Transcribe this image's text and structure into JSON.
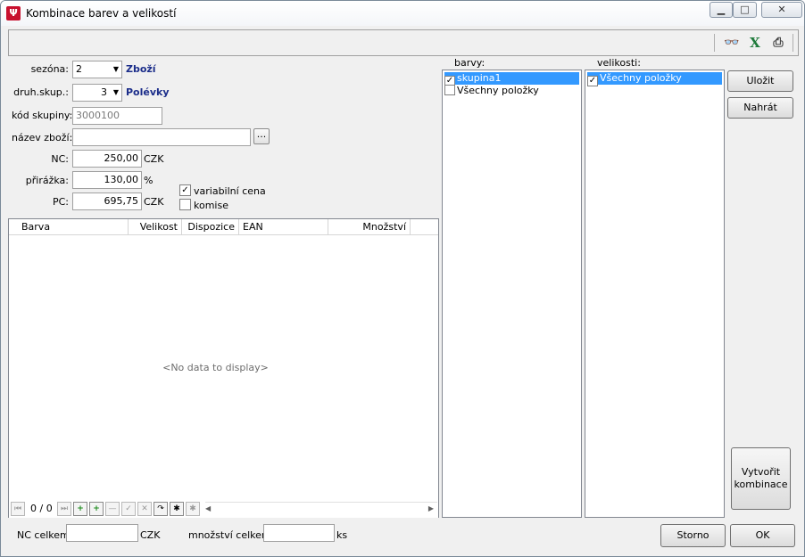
{
  "window": {
    "title": "Kombinace barev a velikostí"
  },
  "form": {
    "sezona_label": "sezóna:",
    "sezona_value": "2",
    "sezona_text": "Zboží",
    "druh_label": "druh.skup.:",
    "druh_value": "3",
    "druh_text": "Polévky",
    "kod_label": "kód skupiny:",
    "kod_value": "3000100",
    "nazev_label": "název zboží:",
    "nazev_value": "",
    "nazev_button": "...",
    "nc_label": "NC:",
    "nc_value": "250,00",
    "nc_unit": "CZK",
    "prirazka_label": "přirážka:",
    "prirazka_value": "130,00",
    "prirazka_unit": "%",
    "pc_label": "PC:",
    "pc_value": "695,75",
    "pc_unit": "CZK",
    "variabilni_label": "variabilní cena",
    "variabilni_checked": true,
    "komise_label": "komise",
    "komise_checked": false
  },
  "grid": {
    "columns": [
      "Barva",
      "Velikost",
      "Dispozice",
      "EAN",
      "Množství"
    ],
    "empty_text": "<No data to display>",
    "nav_position": "0 / 0"
  },
  "barvy": {
    "label": "barvy:",
    "items": [
      {
        "label": "skupina1",
        "checked": true,
        "selected": true
      },
      {
        "label": "Všechny položky",
        "checked": false,
        "selected": false
      }
    ]
  },
  "velikosti": {
    "label": "velikosti:",
    "items": [
      {
        "label": "Všechny položky",
        "checked": true,
        "selected": true
      }
    ]
  },
  "buttons": {
    "ulozit": "Uložit",
    "nahrat": "Nahrát",
    "vytvorit_line1": "Vytvořit",
    "vytvorit_line2": "kombinace",
    "storno": "Storno",
    "ok": "OK"
  },
  "footer": {
    "nc_celkem_label": "NC celkem:",
    "nc_celkem_value": "",
    "nc_celkem_unit": "CZK",
    "mnozstvi_label": "množství celkem:",
    "mnozstvi_value": "",
    "mnozstvi_unit": "ks"
  }
}
